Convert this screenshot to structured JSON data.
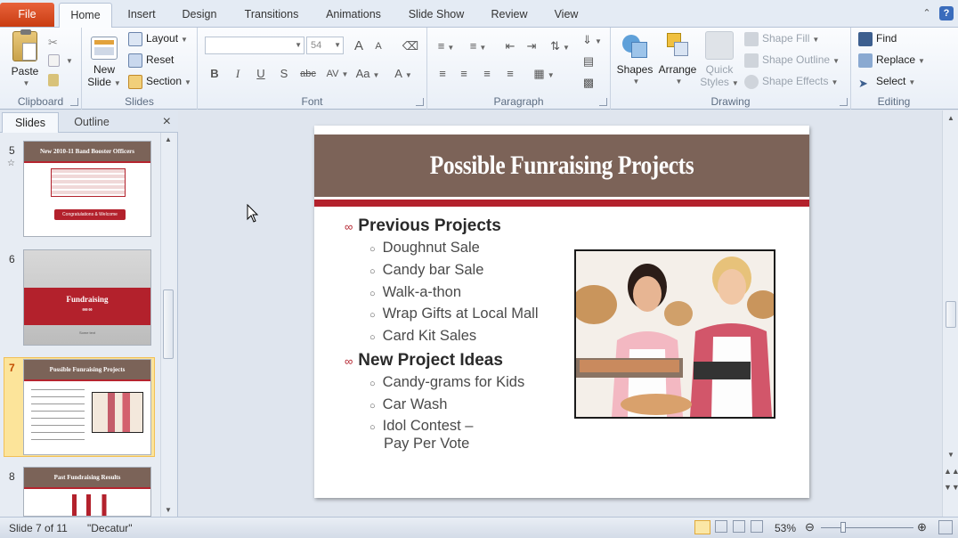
{
  "ribbon_tabs": {
    "file": "File",
    "home": "Home",
    "insert": "Insert",
    "design": "Design",
    "transitions": "Transitions",
    "animations": "Animations",
    "slideshow": "Slide Show",
    "review": "Review",
    "view": "View"
  },
  "clipboard": {
    "paste": "Paste",
    "label": "Clipboard"
  },
  "slides_group": {
    "new_slide_1": "New",
    "new_slide_2": "Slide",
    "layout": "Layout",
    "reset": "Reset",
    "section": "Section",
    "label": "Slides"
  },
  "font": {
    "font_name": "",
    "font_size": "54",
    "label": "Font",
    "grow": "A",
    "shrink": "A",
    "bold": "B",
    "italic": "I",
    "underline": "U",
    "shadow": "S",
    "strike": "abc",
    "spacing": "AV",
    "case": "Aa",
    "color": "A"
  },
  "paragraph": {
    "label": "Paragraph"
  },
  "drawing": {
    "shapes": "Shapes",
    "arrange": "Arrange",
    "quick_styles_1": "Quick",
    "quick_styles_2": "Styles",
    "shape_fill": "Shape Fill",
    "shape_outline": "Shape Outline",
    "shape_effects": "Shape Effects",
    "label": "Drawing"
  },
  "editing": {
    "find": "Find",
    "replace": "Replace",
    "select": "Select",
    "label": "Editing"
  },
  "panel": {
    "tab_slides": "Slides",
    "tab_outline": "Outline",
    "close": "×"
  },
  "thumbnails": [
    {
      "num": "5",
      "title": "New 2010-11 Band Booster Officers",
      "button": "Congratulations & Welcome"
    },
    {
      "num": "6",
      "title": "Fundraising",
      "line1": "000   00",
      "line2": "Some text"
    },
    {
      "num": "7",
      "title": "Possible Funraising Projects"
    },
    {
      "num": "8",
      "title": "Past Fundraising Results"
    }
  ],
  "slide": {
    "title": "Possible Funraising Projects",
    "sections": [
      {
        "heading": "Previous Projects",
        "items": [
          "Doughnut Sale",
          "Candy bar Sale",
          "Walk-a-thon",
          "Wrap Gifts at Local Mall",
          "Card Kit Sales"
        ]
      },
      {
        "heading": "New Project Ideas",
        "items": [
          "Candy-grams for Kids",
          "Car Wash",
          "Idol Contest –"
        ],
        "continuation": "Pay Per Vote"
      }
    ]
  },
  "status": {
    "slide_info": "Slide 7 of 11",
    "theme": "\"Decatur\"",
    "zoom": "53%"
  },
  "colors": {
    "title_bar": "#7c6358",
    "accent_red": "#b3212c",
    "file_tab": "#d9501f"
  }
}
